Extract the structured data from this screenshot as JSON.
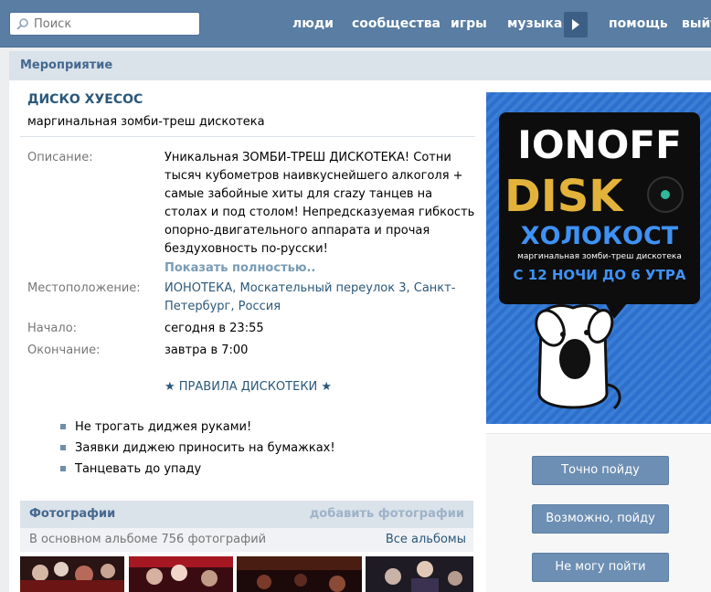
{
  "search": {
    "placeholder": "Поиск"
  },
  "nav": {
    "items": [
      "люди",
      "сообщества",
      "игры",
      "музыка",
      "помощь",
      "выйти"
    ]
  },
  "page": {
    "header": "Мероприятие"
  },
  "event": {
    "title": "ДИСКО ХУЕСОС",
    "subtitle": "маргинальная зомби-треш дискотека",
    "description_label": "Описание:",
    "description": "Уникальная ЗОМБИ-ТРЕШ ДИСКОТЕКА! Сотни тысяч кубометров наивкуснейшего алкоголя + самые забойные хиты для crazy танцев на столах и под столом! Непредсказуемая гибкость опорно-двигательного аппарата и прочая бездуховность по-русски!",
    "show_more": "Показать полностью..",
    "location_label": "Местоположение:",
    "location": "ИОНОТЕКА, Москательный переулок 3, Санкт-Петербург, Россия",
    "start_label": "Начало:",
    "start": "сегодня в 23:55",
    "end_label": "Окончание:",
    "end": "завтра в 7:00",
    "rules_title": "★ ПРАВИЛА ДИСКОТЕКИ ★",
    "rules": [
      "Не трогать диджея руками!",
      "Заявки диджею приносить на бумажках!",
      "Танцевать до упаду"
    ]
  },
  "photos": {
    "title": "Фотографии",
    "add": "добавить фотографии",
    "count": "В основном альбоме 756 фотографий",
    "all_albums": "Все альбомы"
  },
  "poster": {
    "line1": "IONOFF",
    "line2": "DISK",
    "line3": "ХОЛОКОСТ",
    "tagline": "маргинальная зомби-треш дискотека",
    "time": "С 12 НОЧИ ДО 6 УТРА"
  },
  "rsvp": {
    "going": "Точно пойду",
    "maybe": "Возможно, пойду",
    "not_going": "Не могу пойти"
  },
  "colors": {
    "topbar": "#597da3",
    "link": "#2b587a",
    "button": "#6d8fb3",
    "poster_bg": "#2d6fcc"
  }
}
